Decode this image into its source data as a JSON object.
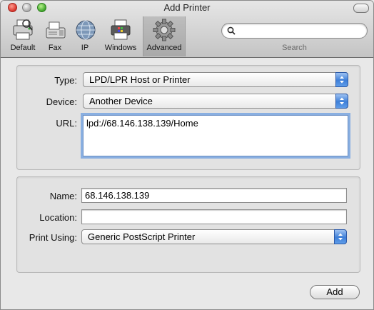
{
  "window": {
    "title": "Add Printer"
  },
  "toolbar": {
    "items": [
      {
        "label": "Default",
        "icon": "default-printer-icon"
      },
      {
        "label": "Fax",
        "icon": "fax-icon"
      },
      {
        "label": "IP",
        "icon": "ip-globe-icon"
      },
      {
        "label": "Windows",
        "icon": "windows-printer-icon"
      },
      {
        "label": "Advanced",
        "icon": "advanced-gear-icon",
        "selected": true
      }
    ],
    "search": {
      "label": "Search",
      "value": ""
    }
  },
  "connection": {
    "type_label": "Type:",
    "type_value": "LPD/LPR Host or Printer",
    "device_label": "Device:",
    "device_value": "Another Device",
    "url_label": "URL:",
    "url_value": "lpd://68.146.138.139/Home"
  },
  "details": {
    "name_label": "Name:",
    "name_value": "68.146.138.139",
    "location_label": "Location:",
    "location_value": "",
    "print_using_label": "Print Using:",
    "print_using_value": "Generic PostScript Printer"
  },
  "actions": {
    "add_label": "Add"
  },
  "colors": {
    "accent": "#3e7fd8",
    "focus_ring": "#6b9de0"
  }
}
